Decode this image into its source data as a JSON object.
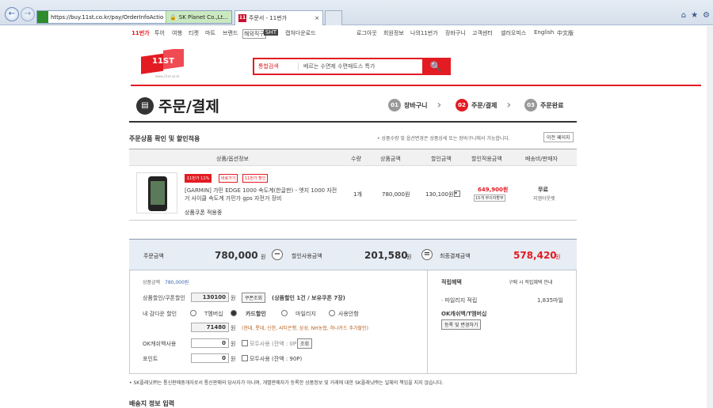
{
  "browser": {
    "url": "https://buy.11st.co.kr/pay/OrderInfoActio",
    "security_label": "SK Planet Co.,Lt...",
    "tab_title": "주문서 - 11번가",
    "tab_favicon": "11",
    "back_icon": "←",
    "forward_icon": "→",
    "win_icons": [
      "⌂",
      "★",
      "⚙"
    ]
  },
  "top_nav": {
    "items": [
      "11번가",
      "투어",
      "여행",
      "티켓",
      "마트",
      "브랜드",
      "해외직구",
      "SHT",
      "캡처다운로드"
    ],
    "right_links": [
      "로그아웃",
      "회원정보",
      "나의11번가",
      "장바구니",
      "고객센터",
      "셀러오피스",
      "English",
      "中文版"
    ]
  },
  "logo": {
    "text": "11ST",
    "sub": "www.11st.co.kr"
  },
  "search": {
    "category": "통합검색",
    "placeholder": "베르는 수면제 수면매트스 특가",
    "button_icon": "🔍"
  },
  "page": {
    "title": "주문/결제",
    "title_icon": "▤"
  },
  "steps": [
    {
      "num": "01",
      "label": "장바구니"
    },
    {
      "num": "02",
      "label": "주문/결제"
    },
    {
      "num": "03",
      "label": "주문완료"
    }
  ],
  "order_section": {
    "title": "주문상품 확인 및 할인적용",
    "notice": "• 상품수량 및 옵션변경은 상품상세 또는 장바구니에서 가능합니다.",
    "prev_button": "이전 페이지",
    "headers": [
      "상품/옵션정보",
      "수량",
      "상품금액",
      "할인금액",
      "할인적용금액",
      "배송비/판매자"
    ],
    "product": {
      "badges": [
        "11%",
        "바로가기",
        "최저가확인"
      ],
      "badge_text": [
        "11번가 11%",
        "바로가기",
        "11번가 할인"
      ],
      "name": "[GARMIN] 가민 EDGE 1000 속도계(한글판) - 엣지 1000 자전거 사이클 속도계 가민가 gps 자전거 장비",
      "coupon_note": "상품쿠폰 적용중",
      "qty": "1개",
      "price": "780,000원",
      "discount": "130,100원",
      "final_price": "649,900원",
      "final_note": "15개 무이자할부",
      "shipping": "무료",
      "seller": "지엠아웃렛"
    }
  },
  "summary": {
    "order_label": "주문금액",
    "order_amount": "780,000",
    "discount_label": "할인사용금액",
    "discount_amount": "201,580",
    "final_label": "최종결제금액",
    "final_amount": "578,420",
    "unit": "원",
    "minus": "−",
    "equals": "="
  },
  "payment": {
    "product_amount_label": "상품금액",
    "product_amount": "780,000원",
    "coupon_label": "상품할인/쿠폰할인",
    "coupon_value": "130100",
    "coupon_unit": "원",
    "coupon_button": "쿠폰조회",
    "coupon_info": "(상품할인 1건 / 보유쿠폰 7장)",
    "card_label": "내 감다운 할인",
    "card_options": [
      "T멤버십",
      "카드할인",
      "마일리지",
      "사용안함"
    ],
    "card_value": "71480",
    "card_unit": "원",
    "card_note": "(현대, 롯데, 신한, 씨티은행, 삼성, NH농협, 하나카드 추가할인)",
    "ok_label": "OK캐쉬백사용",
    "ok_value": "0",
    "ok_unit": "원",
    "ok_all": "모두사용 (잔액 : 0P)",
    "ok_button": "조회",
    "point_label": "포인트",
    "point_value": "0",
    "point_unit": "원",
    "point_all": "모두사용 (잔액 : 90P)"
  },
  "benefits": {
    "title": "적립혜택",
    "link": "구매 시 적립혜택 안내",
    "mileage_label": "· 마일리지 적립",
    "mileage_value": "1,835마일",
    "ok_label": "OK캐쉬백/T멤버십",
    "register_button": "등록 및 변경하기"
  },
  "footnote": "• SK플래닛㈜는 통신판매중개자로서 통신판매의 당사자가 아니며, 개별판매자가 등록한 상품정보 및 거래에 대한 SK플래닛㈜는 일체의 책임을 지지 않습니다.",
  "next_section": "배송지 정보 입력"
}
